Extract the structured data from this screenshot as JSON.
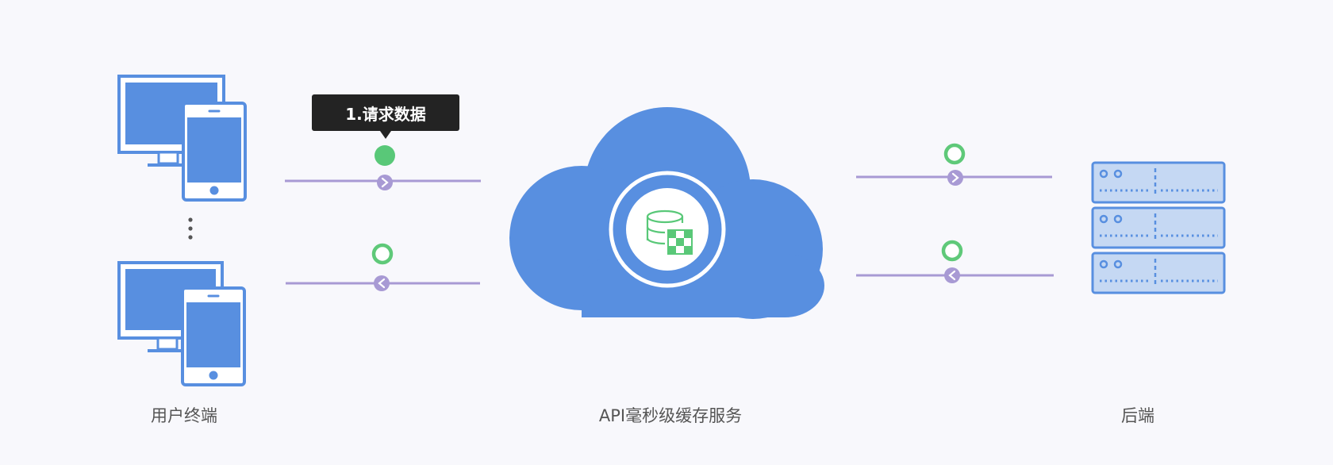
{
  "nodes": {
    "client": {
      "label": "用户终端"
    },
    "cache": {
      "label": "API毫秒级缓存服务"
    },
    "backend": {
      "label": "后端"
    }
  },
  "steps": {
    "active_step_label": "1.请求数据"
  },
  "colors": {
    "primary_blue": "#588fe0",
    "light_blue": "#c5d8f3",
    "line_purple": "#a89ad4",
    "active_green": "#59c878",
    "ring_green": "#5fc979",
    "background": "#f8f8fc"
  },
  "icons": {
    "client": [
      "desktop-monitor-icon",
      "smartphone-icon",
      "ellipsis-vertical-icon"
    ],
    "cache": [
      "cloud-icon",
      "database-cache-icon"
    ],
    "backend": [
      "server-rack-icon"
    ],
    "connectors": [
      "chevron-right-icon",
      "chevron-left-icon"
    ]
  }
}
